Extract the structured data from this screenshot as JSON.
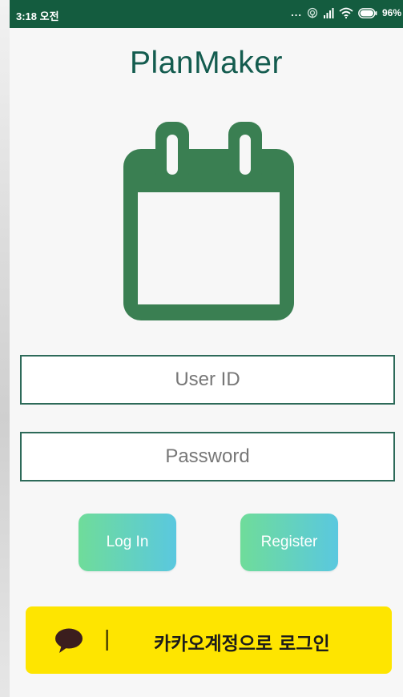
{
  "status_bar": {
    "time": "3:18 오전",
    "dots": "...",
    "battery": "96%"
  },
  "app": {
    "title": "PlanMaker"
  },
  "form": {
    "user_id_placeholder": "User ID",
    "password_placeholder": "Password"
  },
  "buttons": {
    "login": "Log In",
    "register": "Register"
  },
  "kakao": {
    "separator": "|",
    "label": "카카오계정으로 로그인"
  },
  "colors": {
    "status_bar": "#145c3f",
    "title": "#145c4f",
    "calendar": "#3a7f52",
    "button_gradient_start": "#6fdc9a",
    "button_gradient_end": "#5ac8df",
    "kakao_yellow": "#fee500"
  },
  "icons": {
    "status": [
      "hotspot-icon",
      "signal-icon",
      "wifi-icon",
      "battery-icon"
    ],
    "hero": "calendar-icon",
    "kakao": "chat-bubble-icon"
  }
}
